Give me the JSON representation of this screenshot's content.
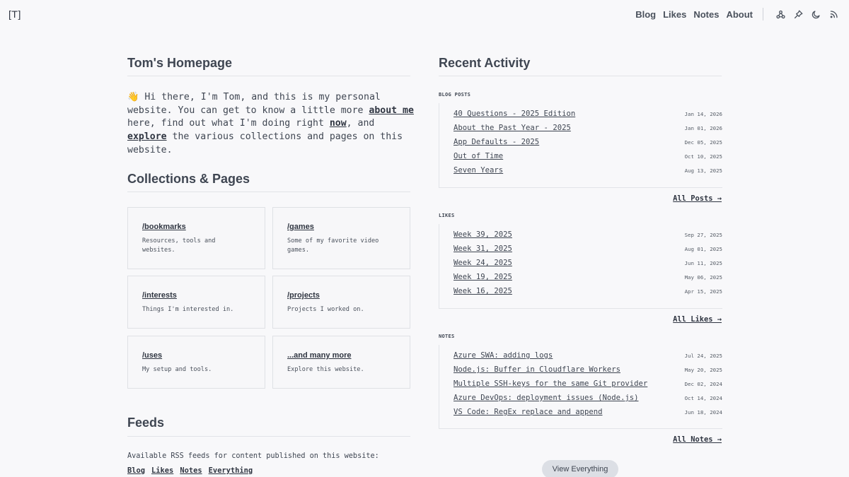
{
  "header": {
    "logo": "[T]",
    "nav": [
      "Blog",
      "Likes",
      "Notes",
      "About"
    ],
    "icons": [
      "graph-icon",
      "pin-icon",
      "moon-icon",
      "rss-icon"
    ]
  },
  "home": {
    "title": "Tom's Homepage",
    "intro": {
      "p1": "👋 Hi there, I'm Tom, and this is my personal website. You can get to know a little more ",
      "link1": "about me",
      "p2": " here, find out what I'm doing right ",
      "link2": "now",
      "p3": ", and ",
      "link3": "explore",
      "p4": " the various collections and pages on this website."
    }
  },
  "collections": {
    "title": "Collections & Pages",
    "cards": [
      {
        "title": "/bookmarks",
        "desc": "Resources, tools and websites."
      },
      {
        "title": "/games",
        "desc": "Some of my favorite video games."
      },
      {
        "title": "/interests",
        "desc": "Things I'm interested in."
      },
      {
        "title": "/projects",
        "desc": "Projects I worked on."
      },
      {
        "title": "/uses",
        "desc": "My setup and tools."
      },
      {
        "title": "...and many more",
        "desc": "Explore this website."
      }
    ]
  },
  "feeds": {
    "title": "Feeds",
    "text": "Available RSS feeds for content published on this website:",
    "links": [
      "Blog",
      "Likes",
      "Notes",
      "Everything"
    ]
  },
  "activity": {
    "title": "Recent Activity",
    "sections": [
      {
        "label": "BLOG POSTS",
        "items": [
          {
            "title": "40 Questions - 2025 Edition",
            "date": "Jan 14, 2026"
          },
          {
            "title": "About the Past Year - 2025",
            "date": "Jan 01, 2026"
          },
          {
            "title": "App Defaults - 2025",
            "date": "Dec 05, 2025"
          },
          {
            "title": "Out of Time",
            "date": "Oct 10, 2025"
          },
          {
            "title": "Seven Years",
            "date": "Aug 13, 2025"
          }
        ],
        "all": "All Posts →"
      },
      {
        "label": "LIKES",
        "items": [
          {
            "title": "Week 39, 2025",
            "date": "Sep 27, 2025"
          },
          {
            "title": "Week 31, 2025",
            "date": "Aug 01, 2025"
          },
          {
            "title": "Week 24, 2025",
            "date": "Jun 11, 2025"
          },
          {
            "title": "Week 19, 2025",
            "date": "May 06, 2025"
          },
          {
            "title": "Week 16, 2025",
            "date": "Apr 15, 2025"
          }
        ],
        "all": "All Likes →"
      },
      {
        "label": "NOTES",
        "items": [
          {
            "title": "Azure SWA: adding logs",
            "date": "Jul 24, 2025"
          },
          {
            "title": "Node.js: Buffer in Cloudflare Workers",
            "date": "May 20, 2025"
          },
          {
            "title": "Multiple SSH-keys for the same Git provider",
            "date": "Dec 02, 2024"
          },
          {
            "title": "Azure DevOps: deployment issues (Node.js)",
            "date": "Oct 14, 2024"
          },
          {
            "title": "VS Code: RegEx replace and append",
            "date": "Jun 18, 2024"
          }
        ],
        "all": "All Notes →"
      }
    ],
    "button": "View Everything"
  }
}
